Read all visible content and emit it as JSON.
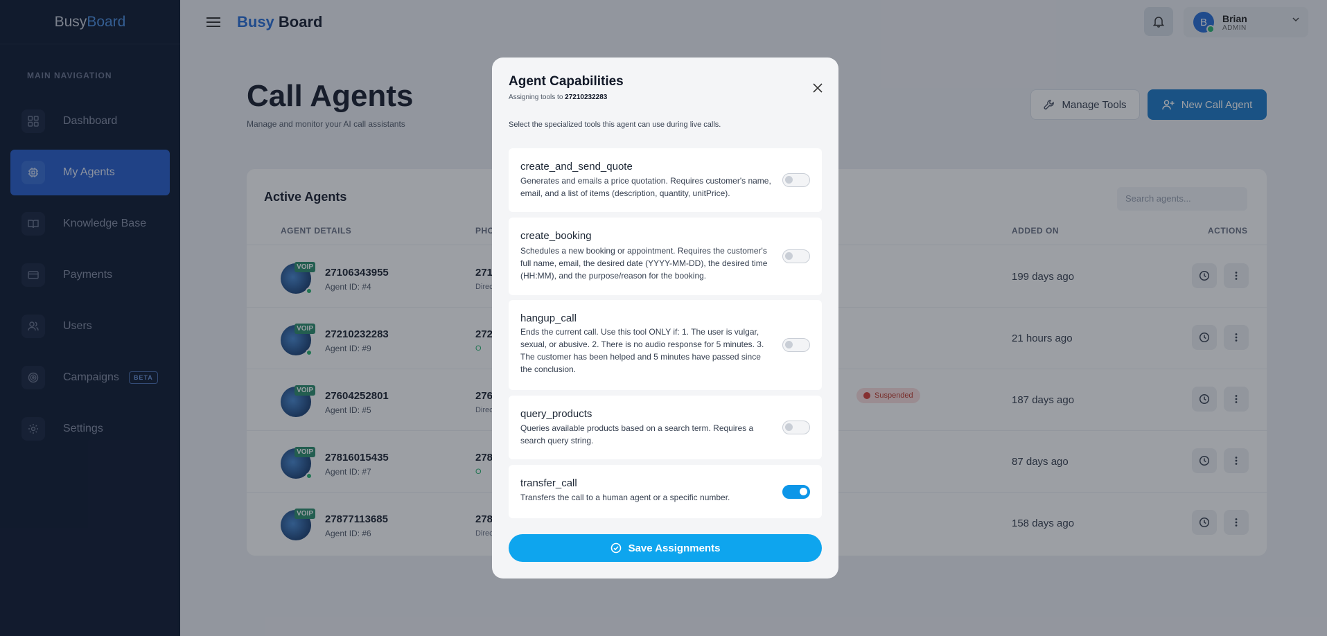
{
  "sidebar": {
    "logo_busy": "Busy",
    "logo_board": "Board",
    "section_label": "MAIN NAVIGATION",
    "items": [
      {
        "label": "Dashboard",
        "icon": "grid-icon"
      },
      {
        "label": "My Agents",
        "icon": "chip-icon",
        "active": true
      },
      {
        "label": "Knowledge Base",
        "icon": "book-icon"
      },
      {
        "label": "Payments",
        "icon": "card-icon"
      },
      {
        "label": "Users",
        "icon": "users-icon"
      },
      {
        "label": "Campaigns",
        "icon": "target-icon",
        "badge": "BETA"
      },
      {
        "label": "Settings",
        "icon": "gear-icon"
      }
    ]
  },
  "topbar": {
    "logo_busy": "Busy",
    "logo_board": "Board",
    "user_initial": "B",
    "user_name": "Brian",
    "user_role": "ADMIN"
  },
  "page": {
    "title": "Call Agents",
    "subtitle": "Manage and monitor your AI call assistants",
    "manage_tools_label": "Manage Tools",
    "new_agent_label": "New Call Agent"
  },
  "agents_card": {
    "title": "Active Agents",
    "search_placeholder": "Search agents...",
    "columns": [
      "AGENT DETAILS",
      "PHO",
      "ADDED ON",
      "ACTIONS"
    ],
    "rows": [
      {
        "number": "27106343955",
        "agent_id": "Agent ID: #4",
        "phone": "271",
        "phone_sub": "Direc",
        "added": "199 days ago"
      },
      {
        "number": "27210232283",
        "agent_id": "Agent ID: #9",
        "phone": "272",
        "phone_sub": "O",
        "added": "21 hours ago"
      },
      {
        "number": "27604252801",
        "agent_id": "Agent ID: #5",
        "phone": "276",
        "phone_sub": "Direc",
        "status": "Suspended",
        "added": "187 days ago"
      },
      {
        "number": "27816015435",
        "agent_id": "Agent ID: #7",
        "phone": "278",
        "phone_sub": "O",
        "added": "87 days ago"
      },
      {
        "number": "27877113685",
        "agent_id": "Agent ID: #6",
        "phone": "278",
        "phone_sub": "Direc",
        "added": "158 days ago"
      }
    ],
    "avatar_badge": "VOIP"
  },
  "modal": {
    "title": "Agent Capabilities",
    "subtitle_prefix": "Assigning tools to",
    "subtitle_agent": "27210232283",
    "description": "Select the specialized tools this agent can use during live calls.",
    "tools": [
      {
        "name": "create_and_send_quote",
        "description": "Generates and emails a price quotation. Requires customer's name, email, and a list of items (description, quantity, unitPrice).",
        "enabled": false
      },
      {
        "name": "create_booking",
        "description": "Schedules a new booking or appointment. Requires the customer's full name, email, the desired date (YYYY-MM-DD), the desired time (HH:MM), and the purpose/reason for the booking.",
        "enabled": false
      },
      {
        "name": "hangup_call",
        "description": "Ends the current call. Use this tool ONLY if: 1. The user is vulgar, sexual, or abusive. 2. There is no audio response for 5 minutes. 3. The customer has been helped and 5 minutes have passed since the conclusion.",
        "enabled": false
      },
      {
        "name": "query_products",
        "description": "Queries available products based on a search term. Requires a search query string.",
        "enabled": false
      },
      {
        "name": "transfer_call",
        "description": "Transfers the call to a human agent or a specific number.",
        "enabled": true
      }
    ],
    "save_label": "Save Assignments"
  },
  "colors": {
    "sidebar_bg": "#111c33",
    "active_nav": "#2a5fcb",
    "primary_button": "#1f7ac8",
    "save_button": "#0ea5ee",
    "toggle_on": "#0d96e8",
    "suspended": "#c0392b"
  }
}
